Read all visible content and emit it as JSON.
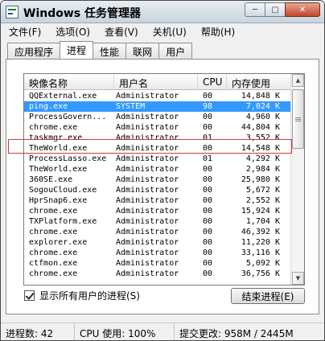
{
  "window": {
    "title": "Windows 任务管理器"
  },
  "caption_buttons": {
    "minimize": "─",
    "restore": "▢",
    "close": "✕"
  },
  "menu": [
    "文件(F)",
    "选项(O)",
    "查看(V)",
    "关机(U)",
    "帮助(H)"
  ],
  "tabs": [
    "应用程序",
    "进程",
    "性能",
    "联网",
    "用户"
  ],
  "active_tab": "进程",
  "columns": [
    "映像名称",
    "用户名",
    "CPU",
    "内存使用"
  ],
  "processes": [
    {
      "name": "QQExternal.exe",
      "user": "Administrator",
      "cpu": "00",
      "mem": "14,848 K"
    },
    {
      "name": "ping.exe",
      "user": "SYSTEM",
      "cpu": "98",
      "mem": "7,024 K",
      "selected": true
    },
    {
      "name": "ProcessGovern...",
      "user": "Administrator",
      "cpu": "00",
      "mem": "4,960 K"
    },
    {
      "name": "chrome.exe",
      "user": "Administrator",
      "cpu": "00",
      "mem": "44,804 K"
    },
    {
      "name": "taskmgr.exe",
      "user": "Administrator",
      "cpu": "01",
      "mem": "3,552 K"
    },
    {
      "name": "TheWorld.exe",
      "user": "Administrator",
      "cpu": "00",
      "mem": "14,548 K"
    },
    {
      "name": "ProcessLasso.exe",
      "user": "Administrator",
      "cpu": "01",
      "mem": "4,292 K"
    },
    {
      "name": "TheWorld.exe",
      "user": "Administrator",
      "cpu": "00",
      "mem": "2,984 K"
    },
    {
      "name": "360SE.exe",
      "user": "Administrator",
      "cpu": "00",
      "mem": "25,980 K"
    },
    {
      "name": "SogouCloud.exe",
      "user": "Administrator",
      "cpu": "00",
      "mem": "5,672 K"
    },
    {
      "name": "HprSnap6.exe",
      "user": "Administrator",
      "cpu": "00",
      "mem": "2,552 K"
    },
    {
      "name": "chrome.exe",
      "user": "Administrator",
      "cpu": "00",
      "mem": "15,924 K"
    },
    {
      "name": "TXPlatform.exe",
      "user": "Administrator",
      "cpu": "00",
      "mem": "1,704 K"
    },
    {
      "name": "chrome.exe",
      "user": "Administrator",
      "cpu": "00",
      "mem": "46,392 K"
    },
    {
      "name": "explorer.exe",
      "user": "Administrator",
      "cpu": "00",
      "mem": "11,220 K"
    },
    {
      "name": "chrome.exe",
      "user": "Administrator",
      "cpu": "00",
      "mem": "33,116 K"
    },
    {
      "name": "ctfmon.exe",
      "user": "Administrator",
      "cpu": "00",
      "mem": "5,092 K"
    },
    {
      "name": "chrome.exe",
      "user": "Administrator",
      "cpu": "00",
      "mem": "36,756 K"
    }
  ],
  "show_all_label": "显示所有用户的进程(S)",
  "end_process_label": "结束进程(E)",
  "status": {
    "processes": "进程数: 42",
    "cpu": "CPU 使用: 100%",
    "commit": "提交更改: 958M / 2445M"
  }
}
